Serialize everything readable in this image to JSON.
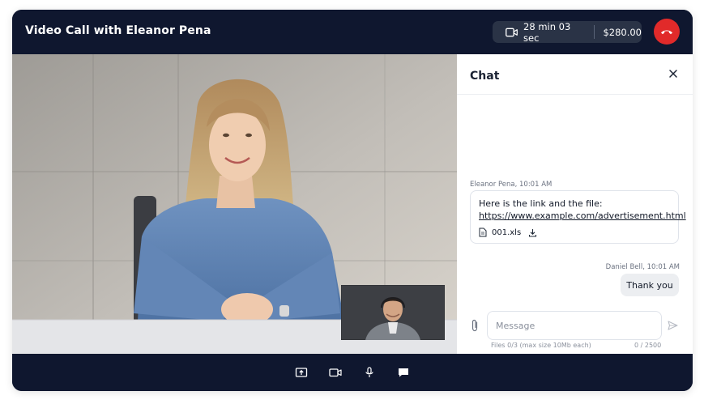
{
  "header": {
    "title": "Video Call with Eleanor Pena",
    "duration": "28 min 03 sec",
    "price": "$280.00",
    "icons": {
      "camera": "video-camera-icon",
      "hangup": "phone-hangup-icon"
    },
    "colors": {
      "background": "#0f172f",
      "pill": "#2a3346",
      "hangup": "#e12a2a"
    }
  },
  "video": {
    "main_participant": "Eleanor Pena",
    "self_view": "Daniel Bell"
  },
  "chat": {
    "title": "Chat",
    "close_icon": "close-icon",
    "messages": [
      {
        "meta": "Eleanor Pena, 10:01 AM",
        "text": "Here is the link and the file:",
        "link": "https://www.example.com/advertisement.html",
        "file_name": "001.xls"
      },
      {
        "meta": "Daniel Bell, 10:01 AM",
        "text": "Thank you"
      }
    ],
    "input": {
      "placeholder": "Message",
      "files_hint": "Files 0/3 (max size 10Mb each)",
      "char_count": "0 / 2500"
    }
  },
  "controls": [
    {
      "name": "share-screen-icon"
    },
    {
      "name": "camera-icon"
    },
    {
      "name": "microphone-icon"
    },
    {
      "name": "chat-icon"
    }
  ]
}
